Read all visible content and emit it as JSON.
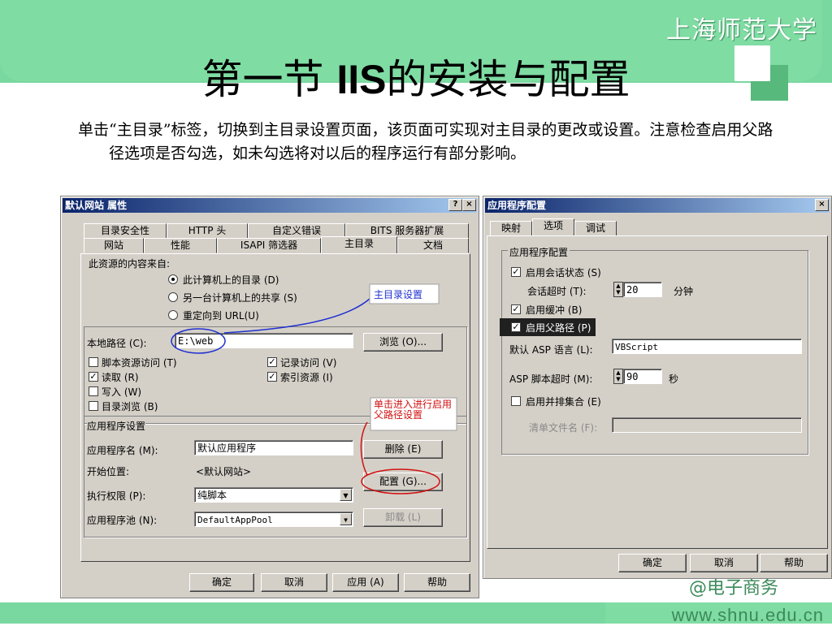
{
  "slide": {
    "university": "上海师范大学",
    "title_prefix": "第一节 ",
    "title_bold": "IIS",
    "title_suffix": "的安装与配置",
    "paragraph": "单击“主目录”标签，切换到主目录设置页面，该页面可实现对主目录的更改或设置。注意检查启用父路径选项是否勾选，如未勾选将对以后的程序运行有部分影响。",
    "footer_url": "www.shnu.edu.cn",
    "footer_logo": "@电子商务"
  },
  "win1": {
    "title": "默认网站 属性",
    "help_btn": "?",
    "close_btn": "×",
    "tabs_row1": [
      "目录安全性",
      "HTTP 头",
      "自定义错误",
      "BITS 服务器扩展"
    ],
    "tabs_row2": [
      "网站",
      "性能",
      "ISAPI 筛选器",
      "主目录",
      "文档"
    ],
    "source_label": "此资源的内容来自:",
    "radio1": "此计算机上的目录 (D)",
    "radio2": "另一台计算机上的共享 (S)",
    "radio3": "重定向到 URL(U)",
    "local_path_label": "本地路径 (C):",
    "local_path_value": "E:\\web",
    "browse_btn": "浏览 (O)...",
    "cb_script_access": "脚本资源访问 (T)",
    "cb_read": "读取 (R)",
    "cb_write": "写入 (W)",
    "cb_dir_browse": "目录浏览 (B)",
    "cb_log": "记录访问 (V)",
    "cb_index": "索引资源 (I)",
    "app_settings": "应用程序设置",
    "app_name_label": "应用程序名 (M):",
    "app_name_value": "默认应用程序",
    "remove_btn": "删除 (E)",
    "start_label": "开始位置:",
    "start_value": "<默认网站>",
    "config_btn": "配置 (G)...",
    "exec_label": "执行权限 (P):",
    "exec_value": "纯脚本",
    "pool_label": "应用程序池 (N):",
    "pool_value": "DefaultAppPool",
    "unload_btn": "卸载 (L)",
    "ok_btn": "确定",
    "cancel_btn": "取消",
    "apply_btn": "应用 (A)",
    "help_bottom_btn": "帮助"
  },
  "win2": {
    "title": "应用程序配置",
    "close_btn": "×",
    "tabs": [
      "映射",
      "选项",
      "调试"
    ],
    "group_label": "应用程序配置",
    "cb_session": "启用会话状态 (S)",
    "session_timeout_label": "会话超时 (T):",
    "session_timeout_value": "20",
    "session_unit": "分钟",
    "cb_buffer": "启用缓冲 (B)",
    "cb_parent_paths": "启用父路径 (P)",
    "asp_lang_label": "默认 ASP 语言 (L):",
    "asp_lang_value": "VBScript",
    "asp_timeout_label": "ASP 脚本超时 (M):",
    "asp_timeout_value": "90",
    "asp_unit": "秒",
    "cb_side_by_side": "启用并排集合 (E)",
    "manifest_label": "清单文件名 (F):",
    "ok_btn": "确定",
    "cancel_btn": "取消",
    "help_btn": "帮助"
  },
  "annotations": {
    "home_dir": "主目录设置",
    "parent_path": "单击进入进行启用父路径设置"
  },
  "colors": {
    "accent_green": "#7fdca3",
    "title_bar": "#0a246a",
    "annotation_blue": "#2030d0",
    "annotation_red": "#d01010"
  }
}
